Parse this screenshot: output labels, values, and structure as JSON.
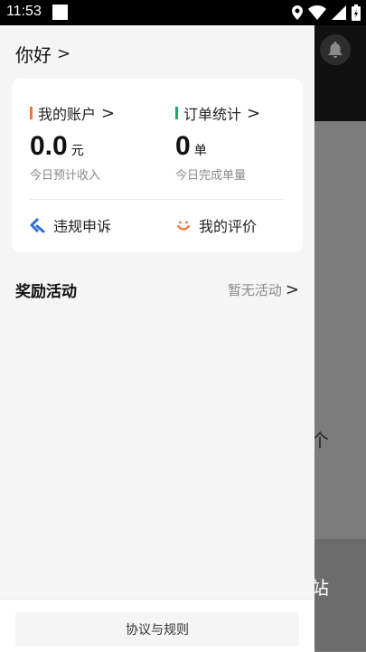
{
  "status_bar": {
    "time": "11:53"
  },
  "drawer": {
    "greeting": "你好",
    "chevron": ">",
    "account": {
      "label": "我的账户",
      "value": "0.0",
      "unit": "元",
      "sub": "今日预计收入",
      "accent": "#f07830"
    },
    "orders": {
      "label": "订单统计",
      "value": "0",
      "unit": "单",
      "sub": "今日完成单量",
      "accent": "#22aa66"
    },
    "links": [
      {
        "label": "违规申诉",
        "icon": "appeal-icon"
      },
      {
        "label": "我的评价",
        "icon": "smile-icon"
      }
    ],
    "rewards": {
      "title": "奖励活动",
      "status": "暂无活动"
    },
    "footer": {
      "button": "协议与规则"
    }
  },
  "background": {
    "text1": "个",
    "text2": "站"
  }
}
